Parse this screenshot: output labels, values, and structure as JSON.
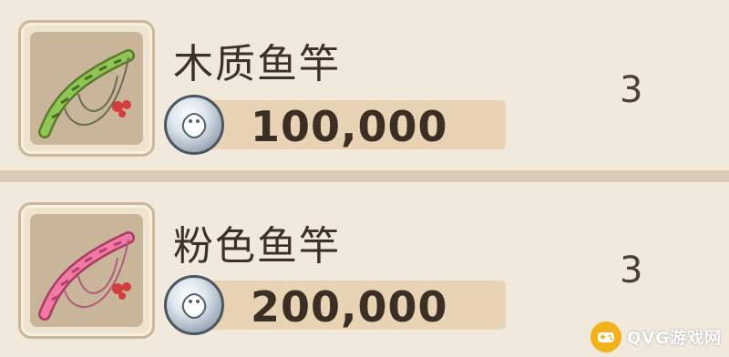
{
  "items": [
    {
      "icon": "wooden-fishing-rod-icon",
      "name": "木质鱼竿",
      "price": "100,000",
      "quantity": "3",
      "rod_color": "#7fb24a"
    },
    {
      "icon": "pink-fishing-rod-icon",
      "name": "粉色鱼竿",
      "price": "200,000",
      "quantity": "3",
      "rod_color": "#e06a96"
    }
  ],
  "currency_icon": "silver-coin-icon",
  "watermark": {
    "icon": "gamepad-icon",
    "text": "QVG游戏网"
  }
}
